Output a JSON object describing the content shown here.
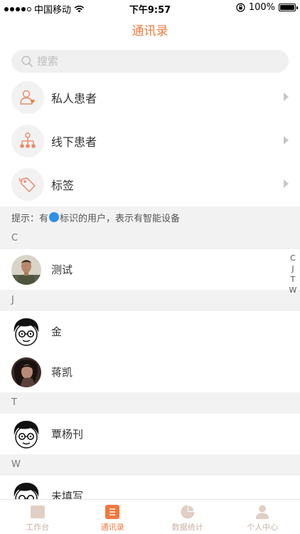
{
  "status_bar": {
    "carrier": "中国移动",
    "time": "下午9:57",
    "battery": "100%"
  },
  "nav": {
    "title": "通讯录"
  },
  "search": {
    "placeholder": "搜索",
    "value": ""
  },
  "menu": [
    {
      "label": "私人患者",
      "icon": "private-patient-icon"
    },
    {
      "label": "线下患者",
      "icon": "offline-patient-icon"
    },
    {
      "label": "标签",
      "icon": "tag-icon"
    }
  ],
  "hint": {
    "prefix": "提示：有",
    "suffix": "标识的用户，表示有智能设备"
  },
  "sections": [
    {
      "letter": "C",
      "contacts": [
        {
          "name": "测试",
          "avatar": "photo-man"
        }
      ]
    },
    {
      "letter": "J",
      "contacts": [
        {
          "name": "金",
          "avatar": "cartoon-glasses"
        },
        {
          "name": "蒋凯",
          "avatar": "photo-woman"
        }
      ]
    },
    {
      "letter": "T",
      "contacts": [
        {
          "name": "覃杨刊",
          "avatar": "cartoon-glasses"
        }
      ]
    },
    {
      "letter": "W",
      "contacts": [
        {
          "name": "未填写",
          "avatar": "cartoon-glasses"
        }
      ]
    }
  ],
  "index": [
    "C",
    "J",
    "T",
    "W"
  ],
  "tabs": [
    {
      "label": "工作台",
      "icon": "workbench-icon",
      "active": false
    },
    {
      "label": "通讯录",
      "icon": "contacts-icon",
      "active": true
    },
    {
      "label": "数据统计",
      "icon": "pie-chart-icon",
      "active": false
    },
    {
      "label": "个人中心",
      "icon": "person-icon",
      "active": false
    }
  ],
  "colors": {
    "accent": "#f0793d",
    "tab_inactive": "#c8b2a4",
    "section_bg": "#f2f2f2",
    "hint_badge": "#2c8fe8"
  }
}
